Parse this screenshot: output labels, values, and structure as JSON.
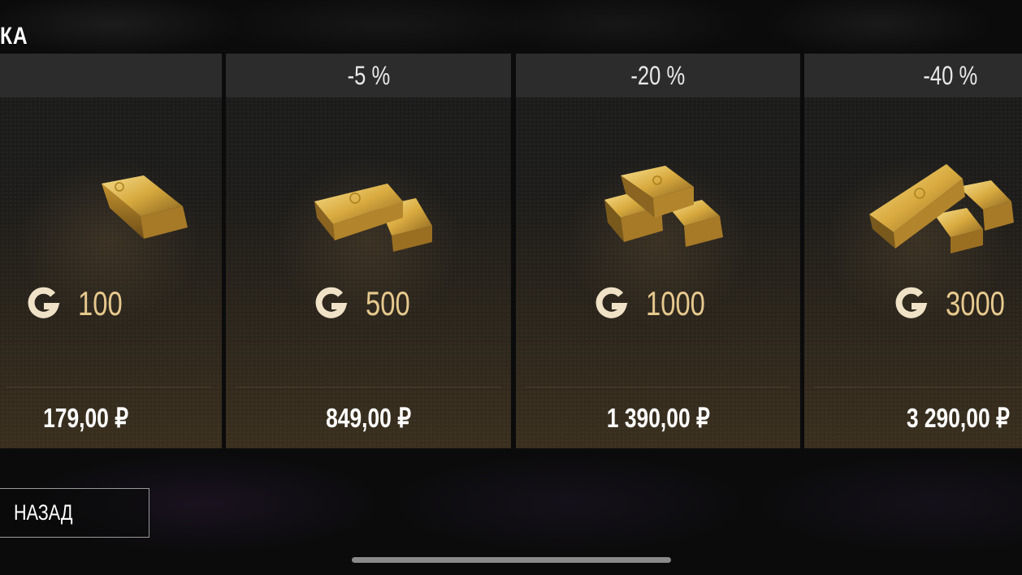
{
  "header": {
    "title": "КА"
  },
  "colors": {
    "gold": "#e7c98e",
    "card_header": "#2c2c2d",
    "background": "#0b0b0c"
  },
  "offers": [
    {
      "discount": "",
      "amount": "100",
      "price": "179,00 ₽",
      "icon": "gold-bar-single-icon"
    },
    {
      "discount": "-5 %",
      "amount": "500",
      "price": "849,00 ₽",
      "icon": "gold-bars-two-icon"
    },
    {
      "discount": "-20 %",
      "amount": "1000",
      "price": "1 390,00 ₽",
      "icon": "gold-bars-pyramid-icon"
    },
    {
      "discount": "-40 %",
      "amount": "3000",
      "price": "3 290,00 ₽",
      "icon": "gold-bars-pile-icon"
    }
  ],
  "back_label": "НАЗАД"
}
